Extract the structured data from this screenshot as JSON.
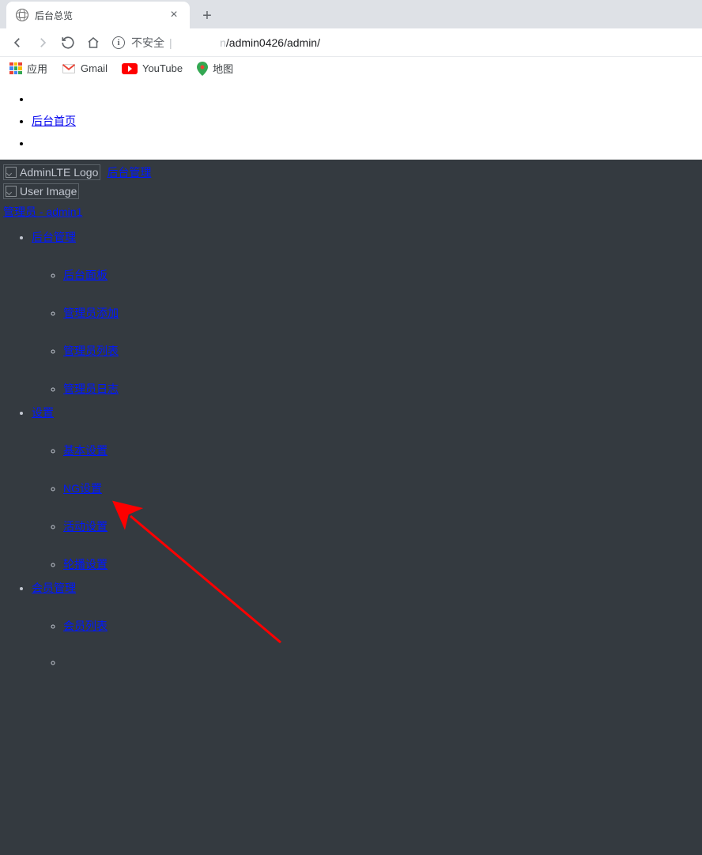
{
  "browser": {
    "tab_title": "后台总览",
    "address": {
      "warning": "不安全",
      "host_suffix": "n",
      "path": "/admin0426/admin/"
    },
    "bookmarks": {
      "apps": "应用",
      "gmail": "Gmail",
      "youtube": "YouTube",
      "maps": "地图"
    }
  },
  "topnav": {
    "home": "后台首页"
  },
  "sidebar": {
    "logo_alt": "AdminLTE Logo",
    "brand": "后台管理",
    "user_image_alt": "User Image",
    "user_label": "管理员 - admin1",
    "sections": [
      {
        "label": "后台管理",
        "items": [
          "后台面板",
          "管理员添加",
          "管理员列表",
          "管理员日志"
        ]
      },
      {
        "label": "设置",
        "items": [
          "基本设置",
          "NG设置",
          "活动设置",
          "轮播设置"
        ]
      },
      {
        "label": "会员管理",
        "items": [
          "会员列表"
        ]
      }
    ]
  }
}
